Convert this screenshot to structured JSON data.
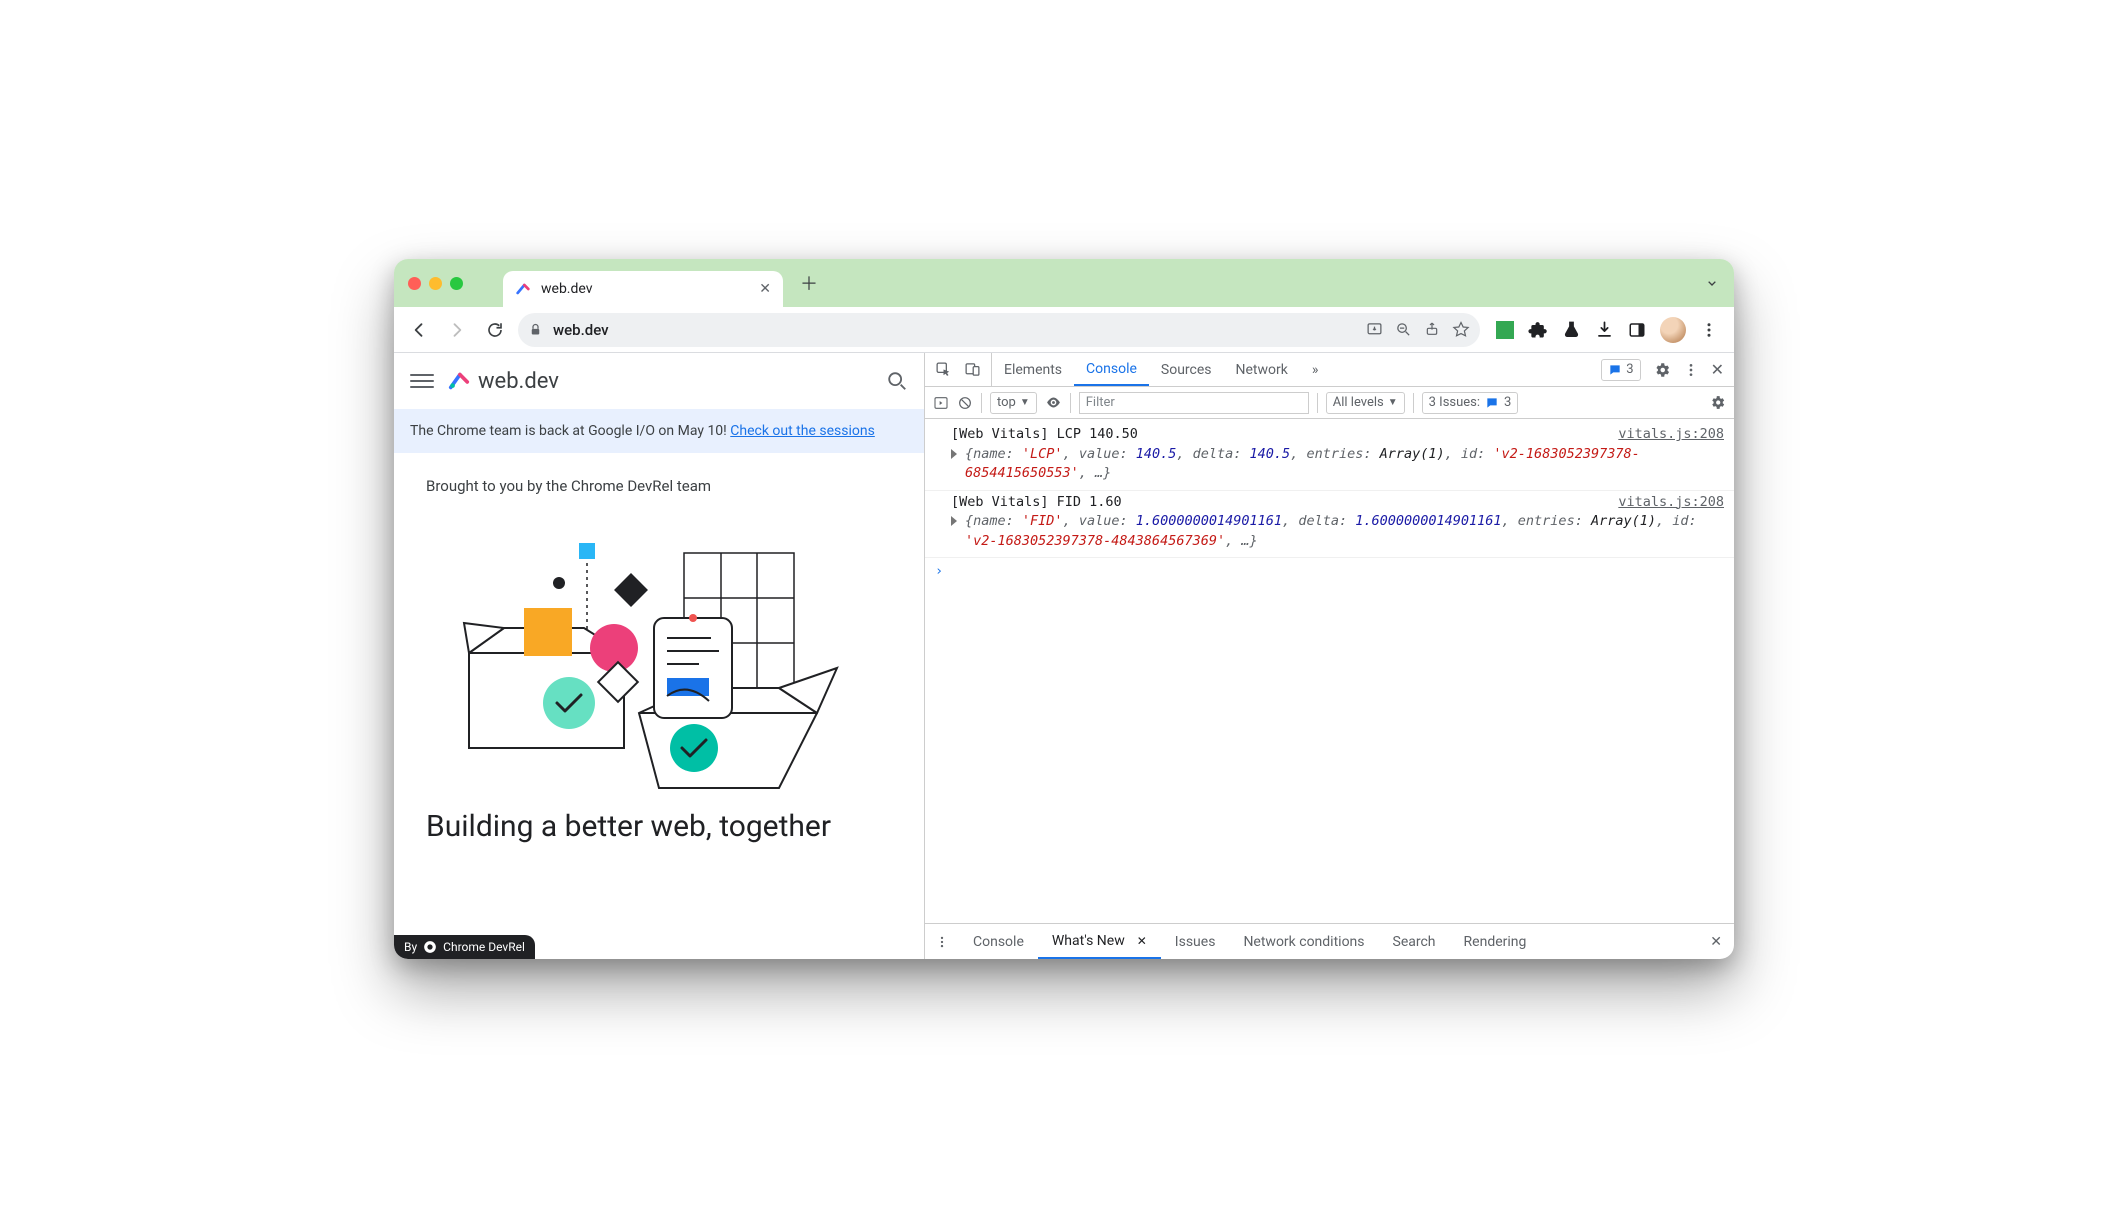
{
  "window": {
    "tab_title": "web.dev",
    "url_display": "web.dev"
  },
  "page": {
    "brand": "web.dev",
    "banner_text": "The Chrome team is back at Google I/O on May 10!",
    "banner_link": "Check out the sessions",
    "byline": "Brought to you by the Chrome DevRel team",
    "headline": "Building a better web, together",
    "devrel_badge_prefix": "By",
    "devrel_badge_name": "Chrome DevRel"
  },
  "devtools": {
    "tabs": [
      "Elements",
      "Console",
      "Sources",
      "Network"
    ],
    "active_tab": "Console",
    "messages_count": "3",
    "toolbar": {
      "context": "top",
      "filter_placeholder": "Filter",
      "levels": "All levels",
      "issues_label": "3 Issues:",
      "issues_count": "3"
    },
    "logs": [
      {
        "header": "[Web Vitals] LCP 140.50",
        "source": "vitals.js:208",
        "object_parts": [
          {
            "t": "punct",
            "v": "{"
          },
          {
            "t": "key",
            "v": "name: "
          },
          {
            "t": "str",
            "v": "'LCP'"
          },
          {
            "t": "punct",
            "v": ", "
          },
          {
            "t": "key",
            "v": "value: "
          },
          {
            "t": "num",
            "v": "140.5"
          },
          {
            "t": "punct",
            "v": ", "
          },
          {
            "t": "key",
            "v": "delta: "
          },
          {
            "t": "num",
            "v": "140.5"
          },
          {
            "t": "punct",
            "v": ", "
          },
          {
            "t": "key",
            "v": "entries: "
          },
          {
            "t": "plain",
            "v": "Array(1)"
          },
          {
            "t": "punct",
            "v": ", "
          },
          {
            "t": "key",
            "v": "id: "
          },
          {
            "t": "str",
            "v": "'v2-1683052397378-6854415650553'"
          },
          {
            "t": "punct",
            "v": ", …}"
          }
        ]
      },
      {
        "header": "[Web Vitals] FID 1.60",
        "source": "vitals.js:208",
        "object_parts": [
          {
            "t": "punct",
            "v": "{"
          },
          {
            "t": "key",
            "v": "name: "
          },
          {
            "t": "str",
            "v": "'FID'"
          },
          {
            "t": "punct",
            "v": ", "
          },
          {
            "t": "key",
            "v": "value: "
          },
          {
            "t": "num",
            "v": "1.6000000014901161"
          },
          {
            "t": "punct",
            "v": ", "
          },
          {
            "t": "key",
            "v": "delta: "
          },
          {
            "t": "num",
            "v": "1.6000000014901161"
          },
          {
            "t": "punct",
            "v": ", "
          },
          {
            "t": "key",
            "v": "entries: "
          },
          {
            "t": "plain",
            "v": "Array(1)"
          },
          {
            "t": "punct",
            "v": ", "
          },
          {
            "t": "key",
            "v": "id: "
          },
          {
            "t": "str",
            "v": "'v2-1683052397378-4843864567369'"
          },
          {
            "t": "punct",
            "v": ", …}"
          }
        ]
      }
    ],
    "drawer_tabs": [
      "Console",
      "What's New",
      "Issues",
      "Network conditions",
      "Search",
      "Rendering"
    ],
    "drawer_active": "What's New"
  }
}
